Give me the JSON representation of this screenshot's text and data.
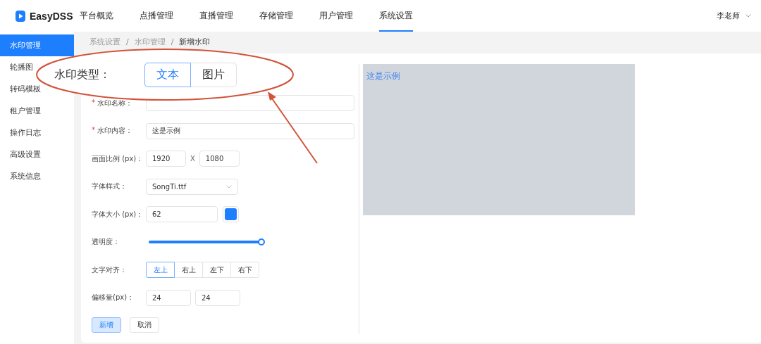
{
  "header": {
    "logo": "EasyDSS",
    "nav": [
      {
        "label": "平台概览",
        "selected": false
      },
      {
        "label": "点播管理",
        "selected": false
      },
      {
        "label": "直播管理",
        "selected": false
      },
      {
        "label": "存储管理",
        "selected": false
      },
      {
        "label": "用户管理",
        "selected": false
      },
      {
        "label": "系统设置",
        "selected": true
      }
    ],
    "user": "李老师"
  },
  "sidebar": {
    "items": [
      {
        "label": "水印管理",
        "selected": true
      },
      {
        "label": "轮播图",
        "selected": false
      },
      {
        "label": "转码模板",
        "selected": false
      },
      {
        "label": "租户管理",
        "selected": false
      },
      {
        "label": "操作日志",
        "selected": false
      },
      {
        "label": "高级设置",
        "selected": false
      },
      {
        "label": "系统信息",
        "selected": false
      }
    ]
  },
  "breadcrumb": {
    "separator": "/",
    "items": [
      "系统设置",
      "水印管理",
      "新增水印"
    ]
  },
  "callout": {
    "label": "水印类型：",
    "options": [
      {
        "label": "文本",
        "selected": true
      },
      {
        "label": "图片",
        "selected": false
      }
    ]
  },
  "form": {
    "fields": [
      {
        "kind": "text",
        "mark": "*",
        "label": "水印名称："
      },
      {
        "kind": "text",
        "mark": "*",
        "label": "水印内容：",
        "value": "这是示例"
      },
      {
        "kind": "pair",
        "label": "画面比例 (px)：",
        "values": [
          "1920",
          "1080"
        ],
        "separator": "X"
      },
      {
        "kind": "select",
        "label": "字体样式：",
        "value": "SongTi.ttf"
      },
      {
        "kind": "size",
        "label": "字体大小 (px)：",
        "value": "62",
        "color": "#1e7ffe"
      },
      {
        "kind": "slider",
        "label": "透明度：",
        "level": 1
      },
      {
        "kind": "segmented",
        "label": "文字对齐：",
        "options": [
          {
            "label": "左上",
            "selected": true
          },
          {
            "label": "右上",
            "selected": false
          },
          {
            "label": "左下",
            "selected": false
          },
          {
            "label": "右下",
            "selected": false
          }
        ]
      },
      {
        "kind": "pair",
        "label": "偏移量(px)：",
        "values": [
          "24",
          "24"
        ]
      }
    ],
    "buttons": [
      {
        "label": "新增",
        "kind": "primary"
      },
      {
        "label": "取消",
        "kind": "default"
      }
    ]
  },
  "preview": {
    "text": "这是示例"
  }
}
